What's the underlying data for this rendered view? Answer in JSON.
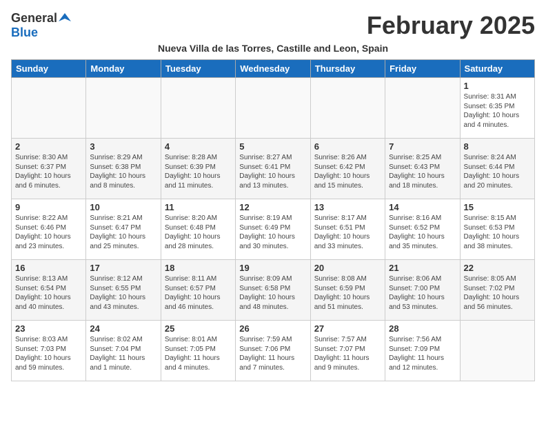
{
  "logo": {
    "general": "General",
    "blue": "Blue"
  },
  "title": "February 2025",
  "subtitle": "Nueva Villa de las Torres, Castille and Leon, Spain",
  "days": [
    "Sunday",
    "Monday",
    "Tuesday",
    "Wednesday",
    "Thursday",
    "Friday",
    "Saturday"
  ],
  "weeks": [
    [
      {
        "day": "",
        "text": ""
      },
      {
        "day": "",
        "text": ""
      },
      {
        "day": "",
        "text": ""
      },
      {
        "day": "",
        "text": ""
      },
      {
        "day": "",
        "text": ""
      },
      {
        "day": "",
        "text": ""
      },
      {
        "day": "1",
        "text": "Sunrise: 8:31 AM\nSunset: 6:35 PM\nDaylight: 10 hours\nand 4 minutes."
      }
    ],
    [
      {
        "day": "2",
        "text": "Sunrise: 8:30 AM\nSunset: 6:37 PM\nDaylight: 10 hours\nand 6 minutes."
      },
      {
        "day": "3",
        "text": "Sunrise: 8:29 AM\nSunset: 6:38 PM\nDaylight: 10 hours\nand 8 minutes."
      },
      {
        "day": "4",
        "text": "Sunrise: 8:28 AM\nSunset: 6:39 PM\nDaylight: 10 hours\nand 11 minutes."
      },
      {
        "day": "5",
        "text": "Sunrise: 8:27 AM\nSunset: 6:41 PM\nDaylight: 10 hours\nand 13 minutes."
      },
      {
        "day": "6",
        "text": "Sunrise: 8:26 AM\nSunset: 6:42 PM\nDaylight: 10 hours\nand 15 minutes."
      },
      {
        "day": "7",
        "text": "Sunrise: 8:25 AM\nSunset: 6:43 PM\nDaylight: 10 hours\nand 18 minutes."
      },
      {
        "day": "8",
        "text": "Sunrise: 8:24 AM\nSunset: 6:44 PM\nDaylight: 10 hours\nand 20 minutes."
      }
    ],
    [
      {
        "day": "9",
        "text": "Sunrise: 8:22 AM\nSunset: 6:46 PM\nDaylight: 10 hours\nand 23 minutes."
      },
      {
        "day": "10",
        "text": "Sunrise: 8:21 AM\nSunset: 6:47 PM\nDaylight: 10 hours\nand 25 minutes."
      },
      {
        "day": "11",
        "text": "Sunrise: 8:20 AM\nSunset: 6:48 PM\nDaylight: 10 hours\nand 28 minutes."
      },
      {
        "day": "12",
        "text": "Sunrise: 8:19 AM\nSunset: 6:49 PM\nDaylight: 10 hours\nand 30 minutes."
      },
      {
        "day": "13",
        "text": "Sunrise: 8:17 AM\nSunset: 6:51 PM\nDaylight: 10 hours\nand 33 minutes."
      },
      {
        "day": "14",
        "text": "Sunrise: 8:16 AM\nSunset: 6:52 PM\nDaylight: 10 hours\nand 35 minutes."
      },
      {
        "day": "15",
        "text": "Sunrise: 8:15 AM\nSunset: 6:53 PM\nDaylight: 10 hours\nand 38 minutes."
      }
    ],
    [
      {
        "day": "16",
        "text": "Sunrise: 8:13 AM\nSunset: 6:54 PM\nDaylight: 10 hours\nand 40 minutes."
      },
      {
        "day": "17",
        "text": "Sunrise: 8:12 AM\nSunset: 6:55 PM\nDaylight: 10 hours\nand 43 minutes."
      },
      {
        "day": "18",
        "text": "Sunrise: 8:11 AM\nSunset: 6:57 PM\nDaylight: 10 hours\nand 46 minutes."
      },
      {
        "day": "19",
        "text": "Sunrise: 8:09 AM\nSunset: 6:58 PM\nDaylight: 10 hours\nand 48 minutes."
      },
      {
        "day": "20",
        "text": "Sunrise: 8:08 AM\nSunset: 6:59 PM\nDaylight: 10 hours\nand 51 minutes."
      },
      {
        "day": "21",
        "text": "Sunrise: 8:06 AM\nSunset: 7:00 PM\nDaylight: 10 hours\nand 53 minutes."
      },
      {
        "day": "22",
        "text": "Sunrise: 8:05 AM\nSunset: 7:02 PM\nDaylight: 10 hours\nand 56 minutes."
      }
    ],
    [
      {
        "day": "23",
        "text": "Sunrise: 8:03 AM\nSunset: 7:03 PM\nDaylight: 10 hours\nand 59 minutes."
      },
      {
        "day": "24",
        "text": "Sunrise: 8:02 AM\nSunset: 7:04 PM\nDaylight: 11 hours\nand 1 minute."
      },
      {
        "day": "25",
        "text": "Sunrise: 8:01 AM\nSunset: 7:05 PM\nDaylight: 11 hours\nand 4 minutes."
      },
      {
        "day": "26",
        "text": "Sunrise: 7:59 AM\nSunset: 7:06 PM\nDaylight: 11 hours\nand 7 minutes."
      },
      {
        "day": "27",
        "text": "Sunrise: 7:57 AM\nSunset: 7:07 PM\nDaylight: 11 hours\nand 9 minutes."
      },
      {
        "day": "28",
        "text": "Sunrise: 7:56 AM\nSunset: 7:09 PM\nDaylight: 11 hours\nand 12 minutes."
      },
      {
        "day": "",
        "text": ""
      }
    ]
  ]
}
